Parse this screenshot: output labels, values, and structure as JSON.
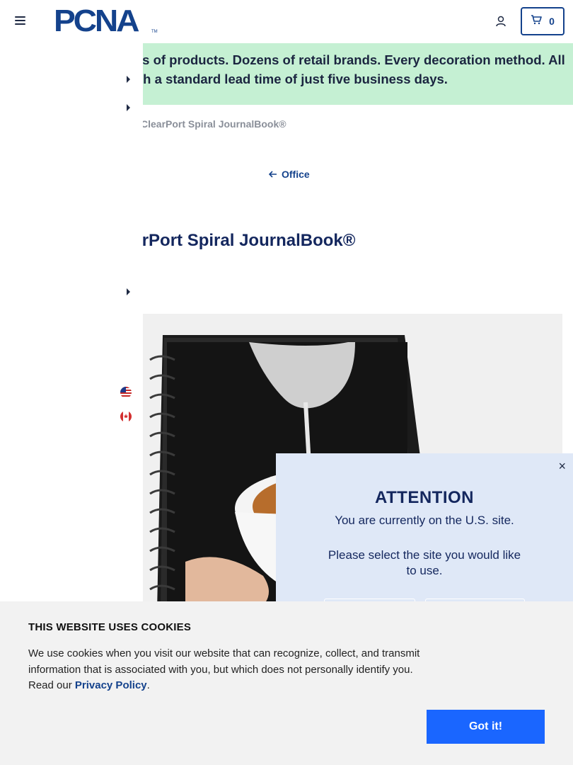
{
  "header": {
    "logo_text": "PCNA",
    "logo_tm": "TM",
    "cart_count": "0"
  },
  "banner": {
    "line1": "ls of products. Dozens of retail brands. Every decoration method. All",
    "line2": "th a standard lead time of just five business days."
  },
  "breadcrumb": {
    "current": "ClearPort Spiral JournalBook®"
  },
  "back_link": {
    "label": "Office"
  },
  "product": {
    "title": "ClearPort Spiral JournalBook®"
  },
  "country_flags": [
    "us-flag-icon",
    "canada-flag-icon"
  ],
  "modal": {
    "close": "×",
    "title": "ATTENTION",
    "line1": "You are currently on the U.S. site.",
    "line2": "Please select the site you would like to use."
  },
  "cookie": {
    "title": "THIS WEBSITE USES COOKIES",
    "body": "We use cookies when you visit our website that can recognize, collect, and transmit information that is associated with you, but which does not personally identify you. Read our",
    "link": "Privacy Policy",
    "period": ".",
    "button": "Got it!"
  },
  "colors": {
    "brand": "#14428c",
    "banner_bg": "#c5f0d3",
    "modal_bg": "#dfe8f7",
    "cookie_button": "#1a66ff"
  }
}
